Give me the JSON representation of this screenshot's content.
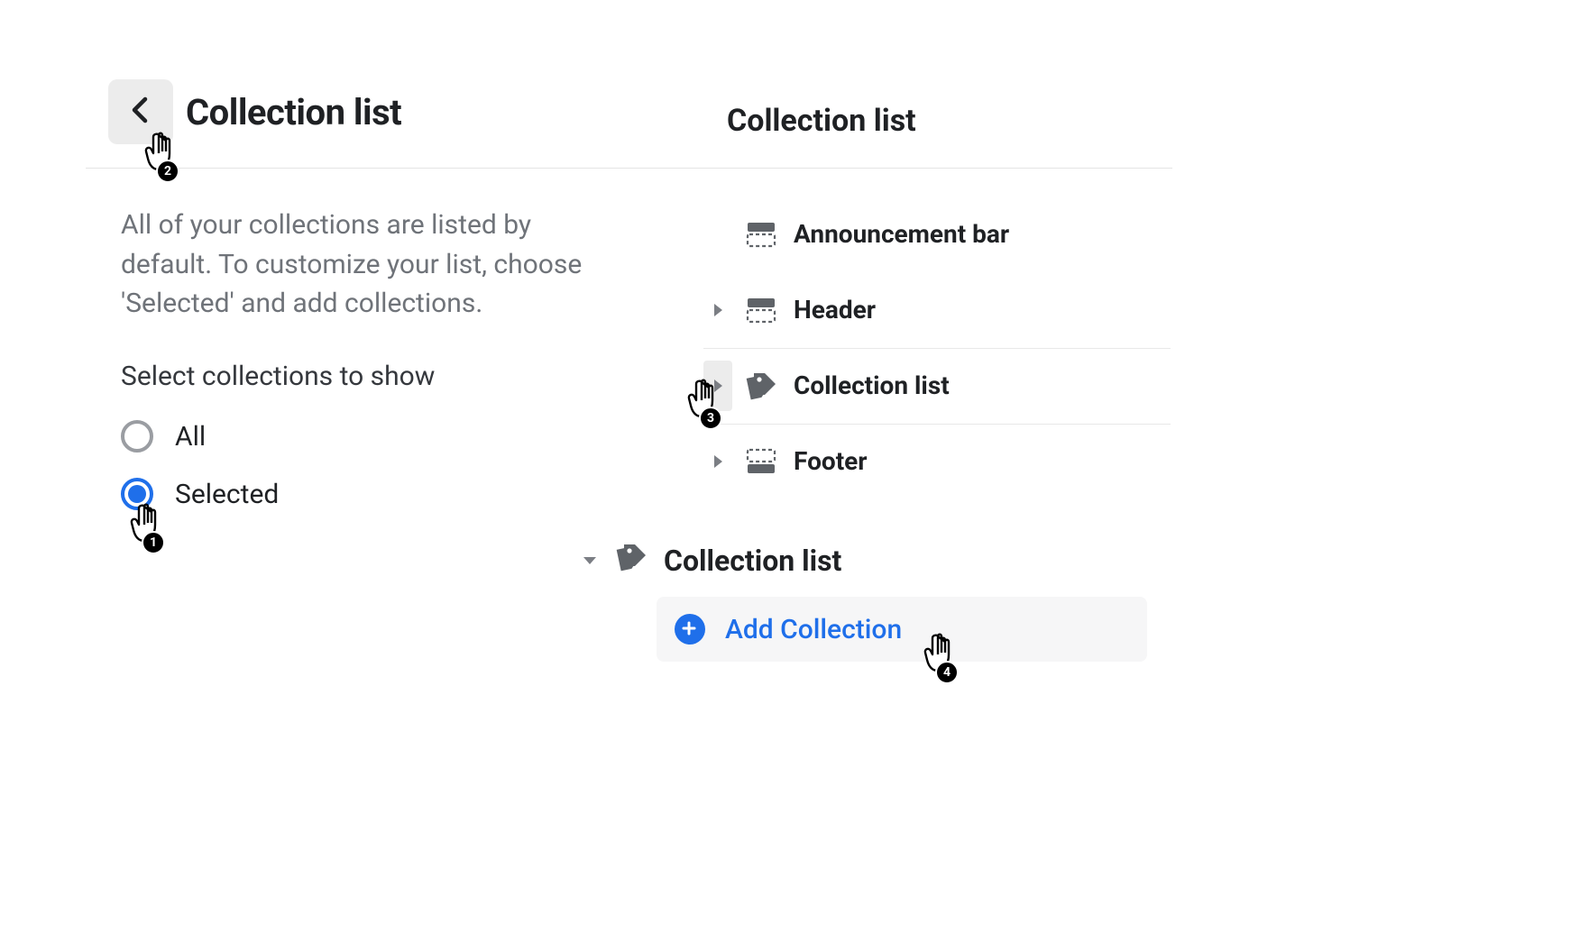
{
  "settings": {
    "title": "Collection list",
    "description": "All of your collections are listed by default. To customize your list, choose 'Selected' and add collections.",
    "section_label": "Select collections to show",
    "options": [
      {
        "label": "All",
        "checked": false
      },
      {
        "label": "Selected",
        "checked": true
      }
    ]
  },
  "tree": {
    "title": "Collection list",
    "rows": [
      {
        "label": "Announcement bar",
        "expandable": false
      },
      {
        "label": "Header",
        "expandable": true
      },
      {
        "label": "Collection list",
        "expandable": true
      },
      {
        "label": "Footer",
        "expandable": true
      }
    ]
  },
  "expanded": {
    "title": "Collection list",
    "add_label": "Add Collection"
  },
  "cursors": {
    "c1": "1",
    "c2": "2",
    "c3": "3",
    "c4": "4"
  }
}
